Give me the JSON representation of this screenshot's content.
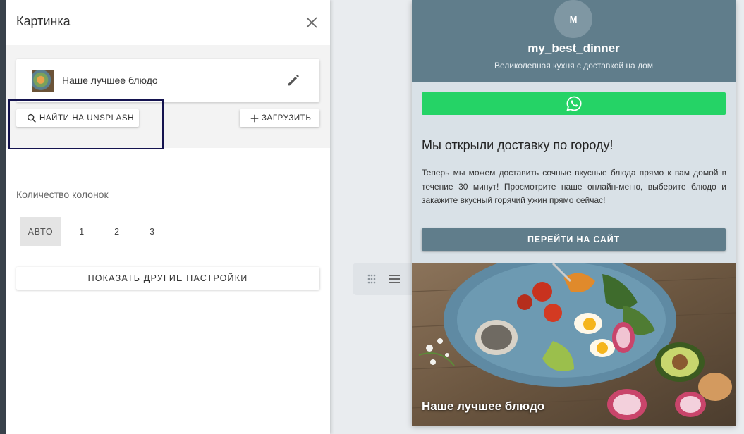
{
  "panel": {
    "title": "Картинка",
    "image_name": "Наше лучшее блюдо",
    "unsplash_label": "НАЙТИ НА UNSPLASH",
    "upload_label": "ЗАГРУЗИТЬ",
    "columns_label": "Количество колонок",
    "column_options": [
      "АВТО",
      "1",
      "2",
      "3"
    ],
    "selected_column": "АВТО",
    "more_settings_label": "ПОКАЗАТЬ ДРУГИЕ НАСТРОЙКИ"
  },
  "preview": {
    "avatar_letter": "M",
    "username": "my_best_dinner",
    "tagline": "Великолепная кухня с доставкой на дом",
    "heading": "Мы открыли доставку по городу!",
    "body": "Теперь мы можем доставить сочные вкусные блюда прямо к вам домой в течение 30 минут! Просмотрите наше онлайн-меню, выберите блюдо и закажите вкусный горячий ужин прямо сейчас!",
    "site_button_label": "ПЕРЕЙТИ НА САЙТ",
    "image_caption": "Наше лучшее блюдо"
  },
  "colors": {
    "profile_bg": "#607d8b",
    "whatsapp": "#25d366",
    "highlight_border": "#14134f",
    "preview_bg": "#d9e1e7"
  },
  "icons": [
    "close-icon",
    "edit-icon",
    "search-icon",
    "plus-icon",
    "drag-handle-icon",
    "menu-icon",
    "whatsapp-icon"
  ]
}
